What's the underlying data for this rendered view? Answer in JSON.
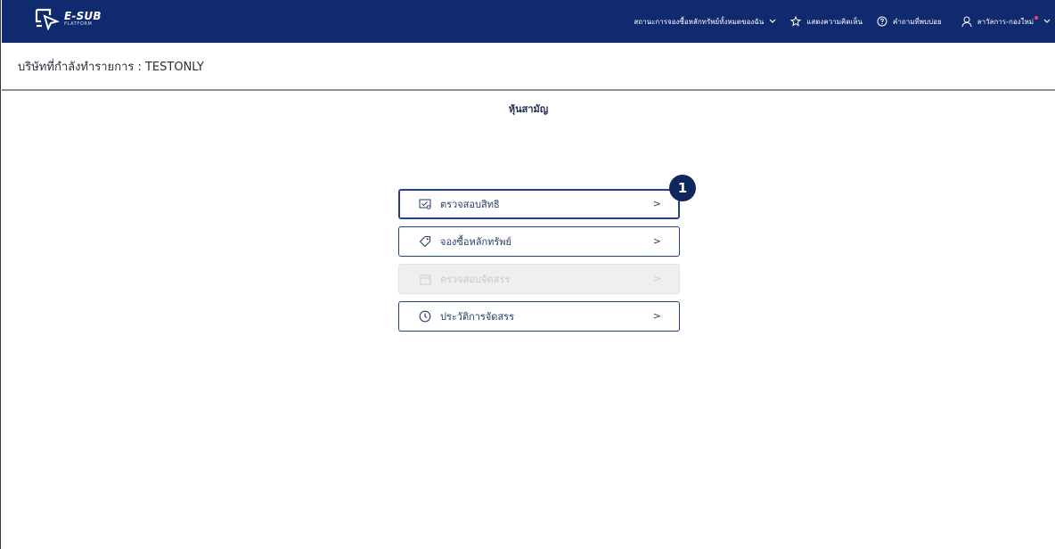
{
  "header": {
    "logo_text": "E-SUB",
    "logo_sub": "PLATFORM",
    "nav": {
      "status_label": "สถานะการจองซื้อหลักทรัพย์ทั้งหมดของฉัน",
      "feedback_label": "แสดงความคิดเห็น",
      "faq_label": "คำถามที่พบบ่อย",
      "user_label": "ลาวัลการ-กองใหม่"
    }
  },
  "company": {
    "label": "บริษัทที่กำลังทำรายการ : TESTONLY"
  },
  "page": {
    "title": "หุ้นสามัญ"
  },
  "menu": {
    "items": [
      {
        "label": "ตรวจสอบสิทธิ",
        "arrow": ">",
        "state": "highlighted",
        "icon": "check-document-icon"
      },
      {
        "label": "จองซื้อหลักทรัพย์",
        "arrow": ">",
        "state": "normal",
        "icon": "tag-icon"
      },
      {
        "label": "ตรวจสอบจัดสรร",
        "arrow": ">",
        "state": "disabled",
        "icon": "calendar-icon"
      },
      {
        "label": "ประวัติการจัดสรร",
        "arrow": ">",
        "state": "normal",
        "icon": "clock-icon"
      }
    ]
  },
  "annotation": {
    "badge_number": "1"
  },
  "colors": {
    "topbar": "#0f2a6e",
    "button_border": "#24408a",
    "disabled_bg": "#efefef",
    "badge": "#10275e"
  }
}
